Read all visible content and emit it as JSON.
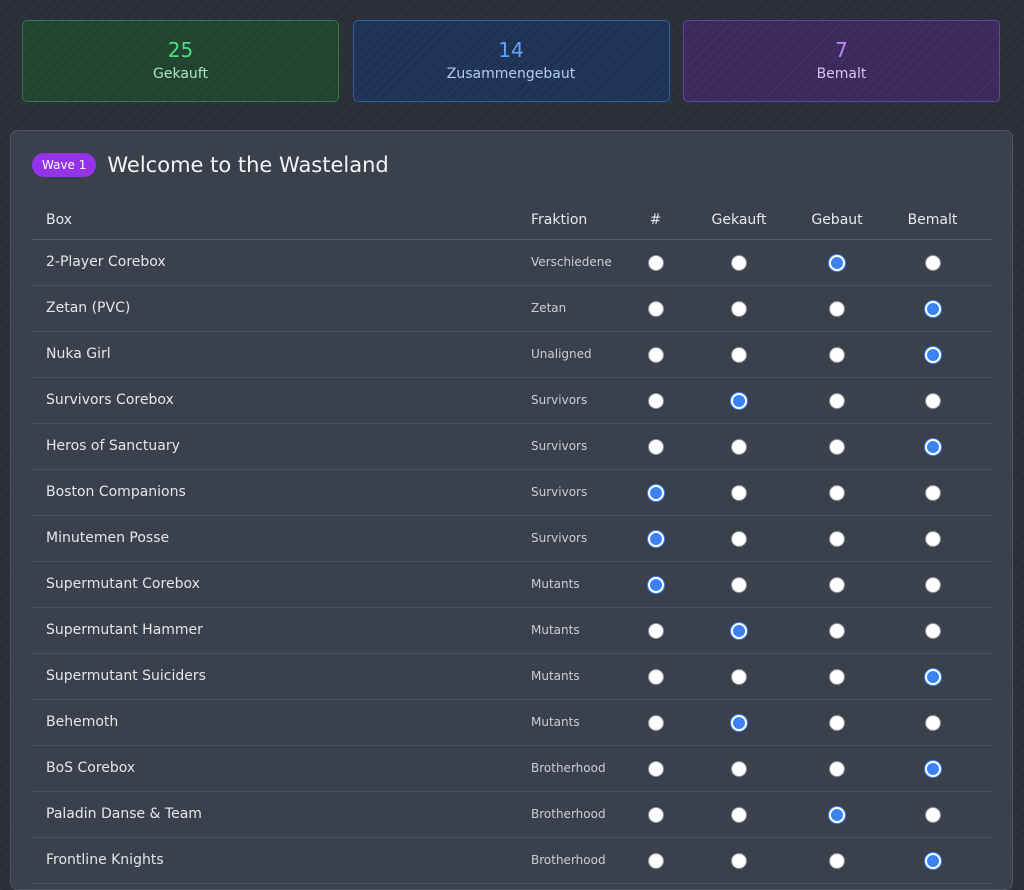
{
  "stats": [
    {
      "value": "25",
      "label": "Gekauft",
      "color": "#4ade80"
    },
    {
      "value": "14",
      "label": "Zusammengebaut",
      "color": "#60a5fa"
    },
    {
      "value": "7",
      "label": "Bemalt",
      "color": "#c084fc"
    }
  ],
  "wave": {
    "badge": "Wave 1",
    "title": "Welcome to the Wasteland"
  },
  "columns": {
    "box": "Box",
    "faction": "Fraktion",
    "count": "#",
    "bought": "Gekauft",
    "built": "Gebaut",
    "painted": "Bemalt"
  },
  "status_options": [
    "count",
    "bought",
    "built",
    "painted"
  ],
  "rows": [
    {
      "name": "2-Player Corebox",
      "faction": "Verschiedene",
      "selected": "built"
    },
    {
      "name": "Zetan (PVC)",
      "faction": "Zetan",
      "selected": "painted"
    },
    {
      "name": "Nuka Girl",
      "faction": "Unaligned",
      "selected": "painted"
    },
    {
      "name": "Survivors Corebox",
      "faction": "Survivors",
      "selected": "bought"
    },
    {
      "name": "Heros of Sanctuary",
      "faction": "Survivors",
      "selected": "painted"
    },
    {
      "name": "Boston Companions",
      "faction": "Survivors",
      "selected": "count"
    },
    {
      "name": "Minutemen Posse",
      "faction": "Survivors",
      "selected": "count"
    },
    {
      "name": "Supermutant Corebox",
      "faction": "Mutants",
      "selected": "count"
    },
    {
      "name": "Supermutant Hammer",
      "faction": "Mutants",
      "selected": "bought"
    },
    {
      "name": "Supermutant Suiciders",
      "faction": "Mutants",
      "selected": "painted"
    },
    {
      "name": "Behemoth",
      "faction": "Mutants",
      "selected": "bought"
    },
    {
      "name": "BoS Corebox",
      "faction": "Brotherhood",
      "selected": "painted"
    },
    {
      "name": "Paladin Danse & Team",
      "faction": "Brotherhood",
      "selected": "built"
    },
    {
      "name": "Frontline Knights",
      "faction": "Brotherhood",
      "selected": "painted"
    }
  ]
}
